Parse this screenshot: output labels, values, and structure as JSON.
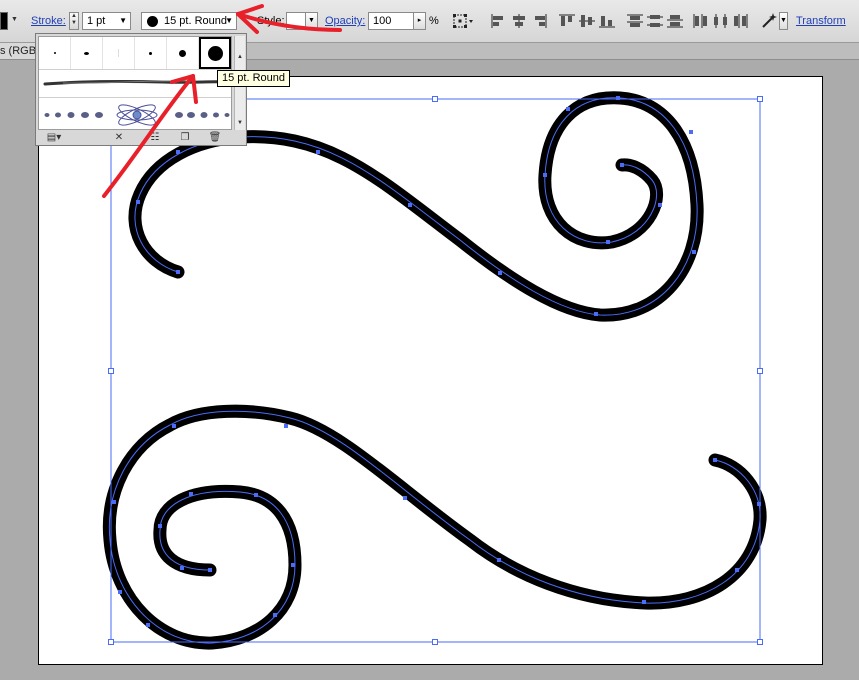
{
  "control_bar": {
    "stroke_label": "Stroke:",
    "stroke_weight": "1 pt",
    "brush_definition": "15 pt. Round",
    "style_label": "Style:",
    "opacity_label": "Opacity:",
    "opacity_value": "100",
    "opacity_unit": "%",
    "transform_label": "Transform"
  },
  "document": {
    "tab_label": "s (RGB/"
  },
  "brush_panel": {
    "tooltip": "15 pt. Round",
    "selected_brush": "15 pt. Round"
  },
  "colors": {
    "selection": "#4a6cf7",
    "annotation_arrow": "#e8202a",
    "stroke": "#000000"
  }
}
